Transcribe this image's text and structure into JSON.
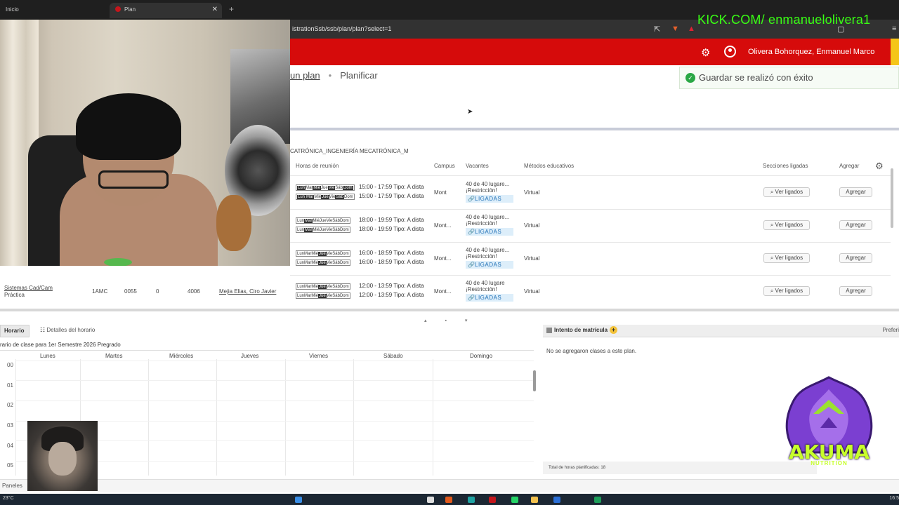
{
  "browser": {
    "tabs": [
      {
        "label": "Inicio"
      },
      {
        "label": "Plan"
      }
    ],
    "url": "istrationSsb/ssb/plan/plan?select=1"
  },
  "stream_overlay": {
    "kick_text": "KICK.COM/ enmanuelolivera1",
    "logo_text": "AKUMA",
    "logo_subtext": "NUTRITION"
  },
  "header": {
    "user_name": "Olivera Bohorquez, Enmanuel Marco",
    "accent_color": "#d60b0b"
  },
  "breadcrumb": {
    "link": "un plan",
    "current": "Planificar"
  },
  "toast": {
    "message": "Guardar se realizó con éxito"
  },
  "results": {
    "career": "CATRÓNICA_INGENIERÍA MECATRÓNICA_M",
    "columns": [
      "Horas de reunión",
      "Campus",
      "Vacantes",
      "Métodos educativos",
      "Secciones ligadas",
      "Agregar"
    ],
    "rows": [
      {
        "times": [
          "15:00 - 17:59 Tipo: A dista",
          "15:00 - 17:59 Tipo: A dista"
        ],
        "campus": "Mont",
        "vacantes": "40 de 40 lugare...",
        "restriccion": "¡Restricción!",
        "link_label": "LIGADAS",
        "metodo": "Virtual",
        "ver": "Ver ligados",
        "agregar": "Agregar"
      },
      {
        "times": [
          "18:00 - 19:59 Tipo: A dista",
          "18:00 - 19:59 Tipo: A dista"
        ],
        "campus": "Mont...",
        "vacantes": "40 de 40 lugare...",
        "restriccion": "¡Restricción!",
        "link_label": "LIGADAS",
        "metodo": "Virtual",
        "ver": "Ver ligados",
        "agregar": "Agregar"
      },
      {
        "times": [
          "16:00 - 18:59 Tipo: A dista",
          "16:00 - 18:59 Tipo: A dista"
        ],
        "campus": "Mont...",
        "vacantes": "40 de 40 lugare...",
        "restriccion": "¡Restricción!",
        "link_label": "LIGADAS",
        "metodo": "Virtual",
        "ver": "Ver ligados",
        "agregar": "Agregar"
      },
      {
        "times": [
          "12:00 - 13:59 Tipo: A dista",
          "12:00 - 13:59 Tipo: A dista"
        ],
        "campus": "Mont...",
        "vacantes": "40 de 40 lugare",
        "restriccion": "¡Restricción!",
        "link_label": "LIGADAS",
        "metodo": "Virtual",
        "ver": "Ver ligados",
        "agregar": "Agregar"
      }
    ],
    "last_row_left": {
      "course": "Sistemas Cad/Cam",
      "type": "Práctica",
      "section": "1AMC",
      "crn": "0055",
      "credits": "0",
      "code": "4006",
      "instructor": "Mejia Elias, Ciro Javier"
    }
  },
  "schedule": {
    "tab_horario": "Horario",
    "tab_detalles": "Detalles del horario",
    "title": "rario de clase para 1er Semestre 2026 Pregrado",
    "days": [
      "Lunes",
      "Martes",
      "Miércoles",
      "Jueves",
      "Viernes",
      "Sábado",
      "Domingo"
    ],
    "hours": [
      "00",
      "01",
      "02",
      "03",
      "04",
      "05"
    ]
  },
  "enrollment": {
    "title": "Intento de matrícula",
    "prefs": "Preferi",
    "empty": "No se agregaron clases a este plan.",
    "total": "Total de horas planificadas: 18"
  },
  "footer": {
    "panels": "Paneles"
  },
  "taskbar": {
    "weather": "23°C",
    "clock": "16:5"
  }
}
